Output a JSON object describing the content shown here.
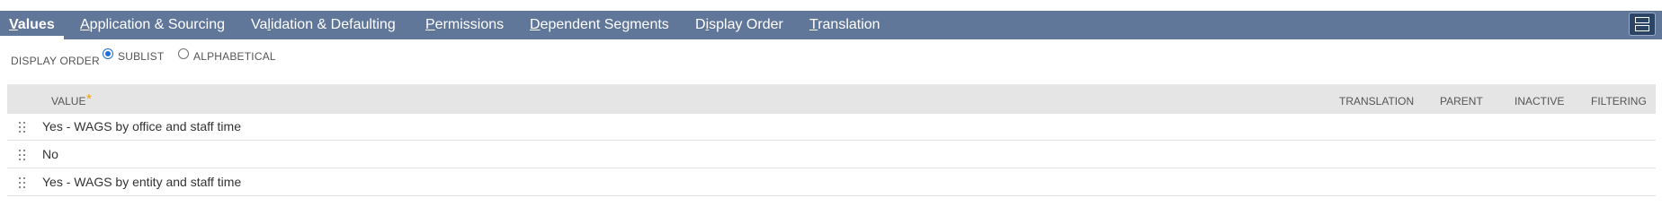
{
  "tabs": [
    {
      "pre": "",
      "u": "V",
      "post": "alues",
      "active": true
    },
    {
      "pre": "",
      "u": "A",
      "post": "pplication & Sourcing",
      "active": false
    },
    {
      "pre": "Va",
      "u": "l",
      "post": "idation & Defaulting",
      "active": false
    },
    {
      "pre": "",
      "u": "P",
      "post": "ermissions",
      "active": false
    },
    {
      "pre": "",
      "u": "D",
      "post": "ependent Segments",
      "active": false
    },
    {
      "pre": "D",
      "u": "i",
      "post": "splay Order",
      "active": false
    },
    {
      "pre": "",
      "u": "T",
      "post": "ranslation",
      "active": false
    }
  ],
  "display_order": {
    "label": "DISPLAY ORDER",
    "options": [
      {
        "label": "SUBLIST",
        "selected": true
      },
      {
        "label": "ALPHABETICAL",
        "selected": false
      }
    ]
  },
  "table": {
    "headers": {
      "value": "VALUE",
      "required_mark": "*",
      "translation": "TRANSLATION",
      "parent": "PARENT",
      "inactive": "INACTIVE",
      "filtering": "FILTERING"
    },
    "rows": [
      {
        "value": "Yes - WAGS by office and staff time"
      },
      {
        "value": "No"
      },
      {
        "value": "Yes - WAGS by entity and staff time"
      }
    ]
  },
  "icons": {
    "layout_toggle": "split-layout-icon",
    "drag_handle": "drag-handle-icon"
  },
  "colors": {
    "tab_bar": "#607799",
    "header_row": "#e5e5e5",
    "radio_selected": "#1f6fd6",
    "required_mark": "#f0a000"
  }
}
